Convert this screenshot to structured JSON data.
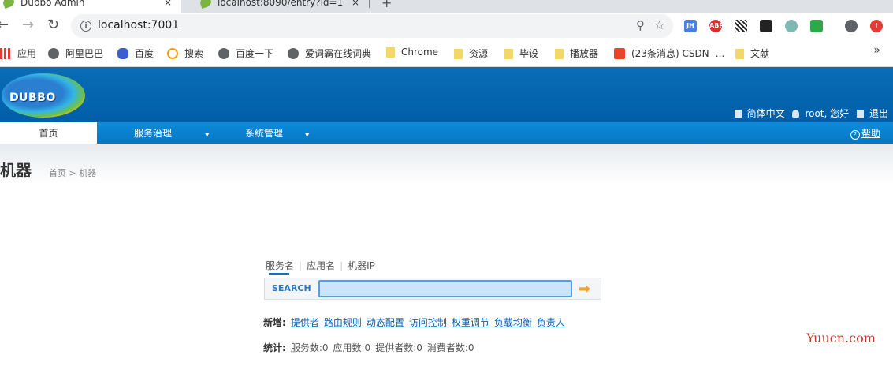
{
  "browser": {
    "tabs": [
      {
        "title": "Dubbo Admin",
        "active": true
      },
      {
        "title": "localhost:8090/entry?id=1",
        "active": false
      }
    ],
    "close_glyph": "×",
    "newtab_glyph": "+",
    "url": "localhost:7001",
    "bookmarks": [
      "应用",
      "阿里巴巴",
      "百度",
      "搜索",
      "百度一下",
      "爱词霸在线词典",
      "Chrome",
      "资源",
      "毕设",
      "播放器",
      "(23条消息) CSDN -...",
      "文献"
    ],
    "more_glyph": "»"
  },
  "header": {
    "logo_text": "DUBBO",
    "lang": "简体中文",
    "user": "root, 您好",
    "logout": "退出"
  },
  "menu": {
    "items": [
      "首页",
      "服务治理",
      "系统管理"
    ],
    "caret": "▼",
    "help": "帮助"
  },
  "page": {
    "title": "机器",
    "breadcrumb": "首页 > 机器"
  },
  "search": {
    "tabs": [
      "服务名",
      "应用名",
      "机器IP"
    ],
    "label": "SEARCH",
    "value": ""
  },
  "add": {
    "label": "新增:",
    "links": [
      "提供者",
      "路由规则",
      "动态配置",
      "访问控制",
      "权重调节",
      "负载均衡",
      "负责人"
    ]
  },
  "stats": {
    "label": "统计:",
    "items": [
      "服务数:0",
      "应用数:0",
      "提供者数:0",
      "消费者数:0"
    ]
  },
  "watermark": "Yuucn.com",
  "colors": {
    "header": "#005ea8",
    "menubar": "#0677c4",
    "link": "#0b5fb0"
  }
}
